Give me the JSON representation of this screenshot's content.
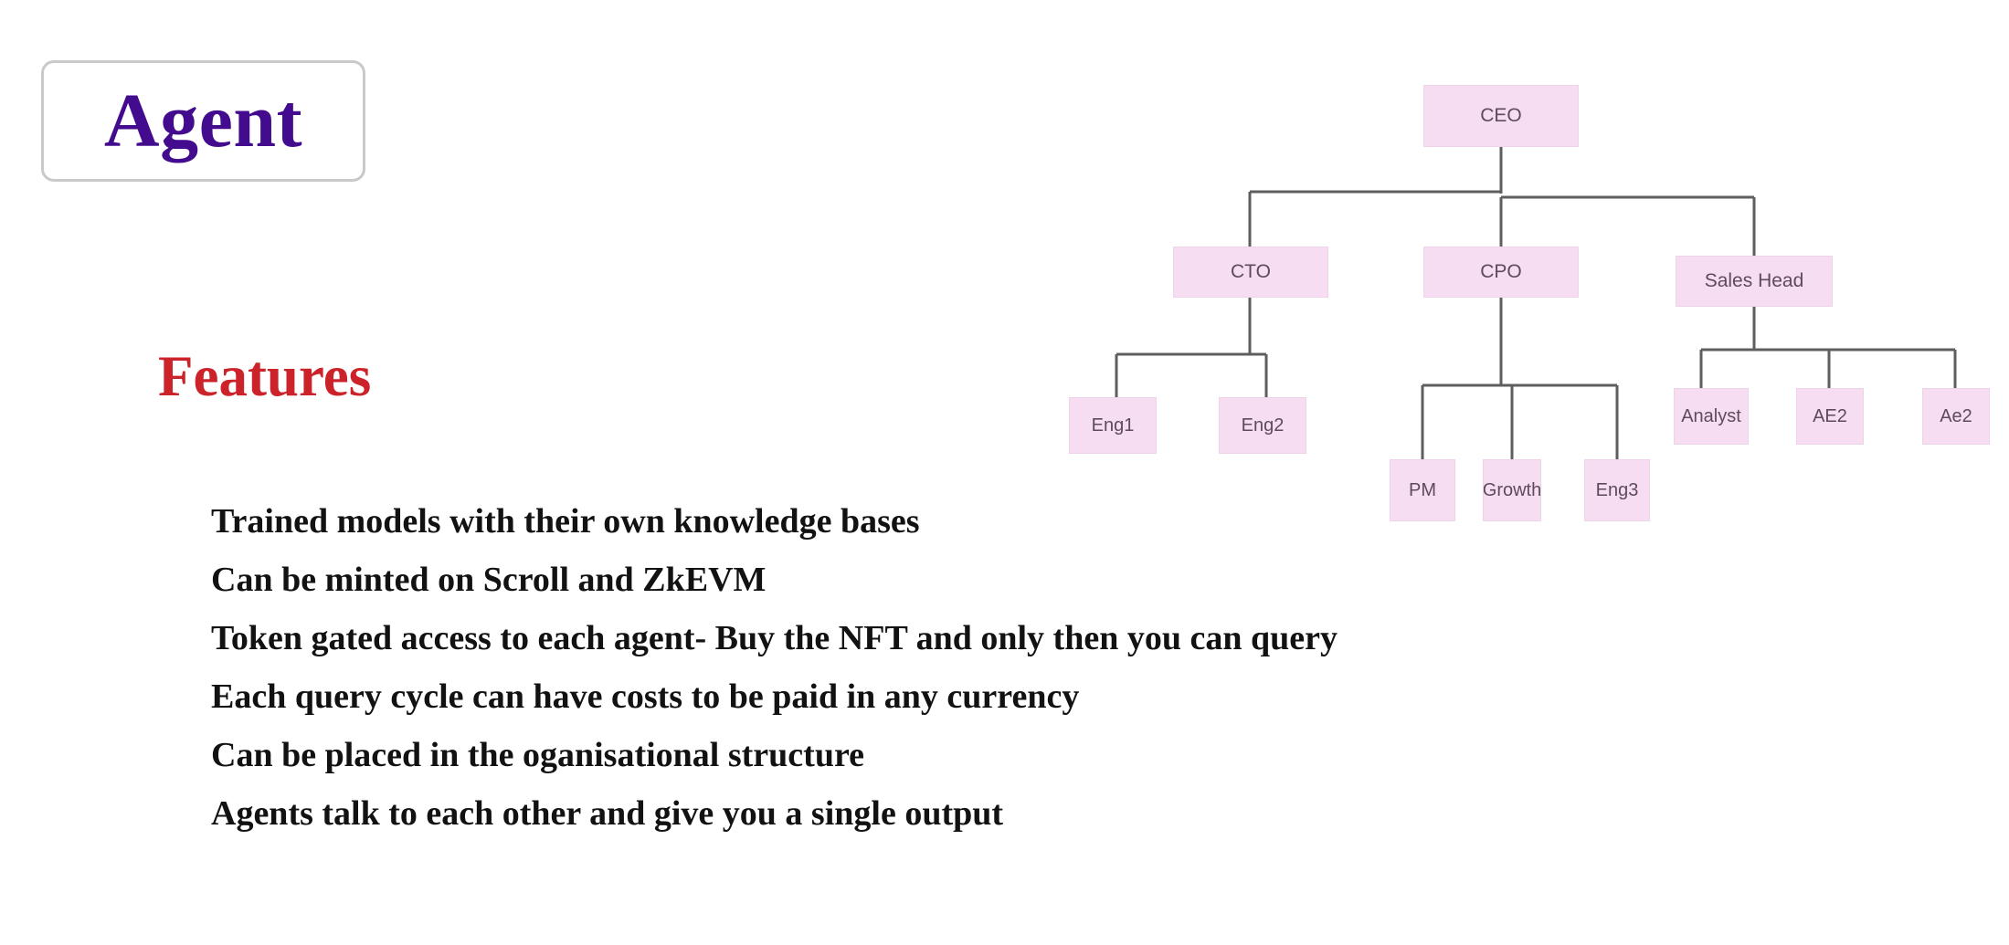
{
  "slide": {
    "background_color": "#ffffff",
    "title_chip": {
      "label": "Agent",
      "text_color": "#430c8f",
      "border_color": "#c9c9c9"
    },
    "features_heading": {
      "label": "Features",
      "color": "#cc2229"
    },
    "features": [
      "Trained models with their own knowledge bases",
      "Can be minted on Scroll and ZkEVM",
      "Token gated access to each agent- Buy the NFT and only then you can query",
      "Each query cycle can have costs to be paid in any currency",
      "Can be placed in the oganisational structure",
      "Agents talk to each other and give you a single output"
    ]
  },
  "org_chart": {
    "node_fill": "#f7ddf2",
    "node_text_color": "#5d4b59",
    "connector_color": "#5e5e5e",
    "nodes": {
      "ceo": "CEO",
      "cto": "CTO",
      "cpo": "CPO",
      "sales_head": "Sales Head",
      "eng1": "Eng1",
      "eng2": "Eng2",
      "pm": "PM",
      "growth": "Growth",
      "eng3": "Eng3",
      "analyst": "Analyst",
      "ae2_upper": "AE2",
      "ae2_lower": "Ae2"
    },
    "edges": [
      [
        "ceo",
        "cto"
      ],
      [
        "ceo",
        "cpo"
      ],
      [
        "ceo",
        "sales_head"
      ],
      [
        "cto",
        "eng1"
      ],
      [
        "cto",
        "eng2"
      ],
      [
        "cpo",
        "pm"
      ],
      [
        "cpo",
        "growth"
      ],
      [
        "cpo",
        "eng3"
      ],
      [
        "sales_head",
        "analyst"
      ],
      [
        "sales_head",
        "ae2_upper"
      ],
      [
        "sales_head",
        "ae2_lower"
      ]
    ]
  }
}
